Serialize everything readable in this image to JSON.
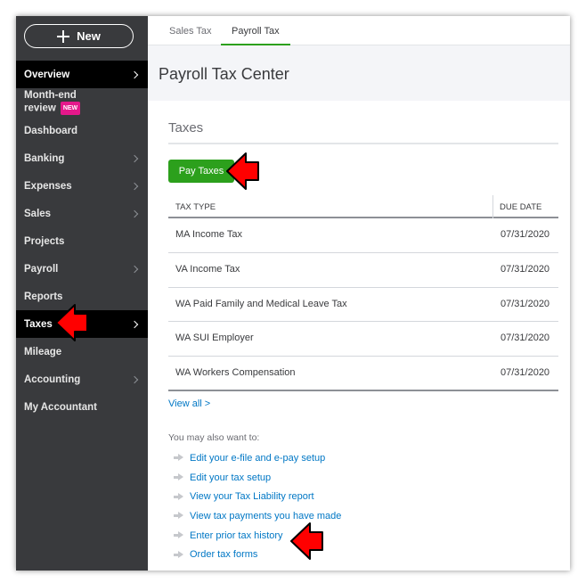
{
  "sidebar": {
    "new_label": "New",
    "items": [
      {
        "label": "Overview",
        "chevron": true,
        "active": true
      },
      {
        "label": "Month-end review",
        "badge": "NEW"
      },
      {
        "label": "Dashboard"
      },
      {
        "label": "Banking",
        "chevron": true
      },
      {
        "label": "Expenses",
        "chevron": true
      },
      {
        "label": "Sales",
        "chevron": true
      },
      {
        "label": "Projects"
      },
      {
        "label": "Payroll",
        "chevron": true
      },
      {
        "label": "Reports"
      },
      {
        "label": "Taxes",
        "chevron": true,
        "active": true
      },
      {
        "label": "Mileage"
      },
      {
        "label": "Accounting",
        "chevron": true
      },
      {
        "label": "My Accountant"
      }
    ]
  },
  "tabs": [
    {
      "label": "Sales Tax",
      "active": false
    },
    {
      "label": "Payroll Tax",
      "active": true
    }
  ],
  "page_title": "Payroll Tax Center",
  "section": {
    "title": "Taxes",
    "pay_button": "Pay Taxes",
    "columns": {
      "tax_type": "TAX TYPE",
      "due_date": "DUE DATE"
    },
    "rows": [
      {
        "tax_type": "MA Income Tax",
        "due_date": "07/31/2020"
      },
      {
        "tax_type": "VA Income Tax",
        "due_date": "07/31/2020"
      },
      {
        "tax_type": "WA Paid Family and Medical Leave Tax",
        "due_date": "07/31/2020"
      },
      {
        "tax_type": "WA SUI Employer",
        "due_date": "07/31/2020"
      },
      {
        "tax_type": "WA Workers Compensation",
        "due_date": "07/31/2020"
      }
    ],
    "view_all": "View all >"
  },
  "also": {
    "label": "You may also want to:",
    "links": [
      "Edit your e-file and e-pay setup",
      "Edit your tax setup",
      "View your Tax Liability report",
      "View tax payments you have made",
      "Enter prior tax history",
      "Order tax forms"
    ]
  },
  "colors": {
    "sidebar_bg": "#393a3d",
    "active_nav": "#000000",
    "accent_green": "#2ca01c",
    "link_blue": "#0077c5",
    "badge_pink": "#e5188b",
    "annotation_red": "#ff0000"
  }
}
